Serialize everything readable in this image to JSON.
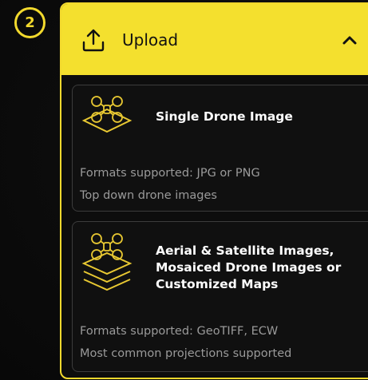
{
  "step": {
    "number": "2"
  },
  "header": {
    "title": "Upload",
    "icon": "upload-icon",
    "toggle_icon": "chevron-up-icon"
  },
  "cards": [
    {
      "title": "Single Drone Image",
      "icon": "drone-single-layer-icon",
      "formats": "Formats supported: JPG or PNG",
      "note": "Top down drone images"
    },
    {
      "title": "Aerial & Satellite Images,\nMosaiced Drone Images or\nCustomized Maps",
      "icon": "drone-stacked-layers-icon",
      "formats": "Formats supported: GeoTIFF, ECW",
      "note": "Most common projections supported"
    }
  ],
  "colors": {
    "accent": "#f4e02e",
    "background": "#0b0b0b",
    "card_border": "#3c3c3c",
    "muted_text": "#9a9a9a"
  }
}
